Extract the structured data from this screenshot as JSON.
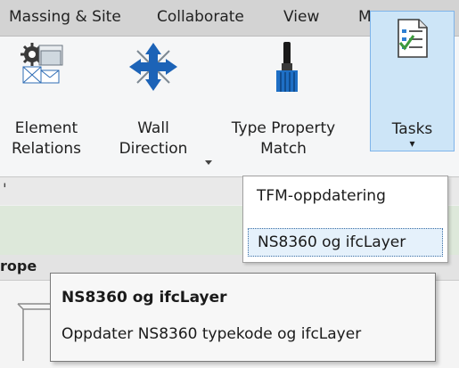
{
  "tabs": [
    "Massing & Site",
    "Collaborate",
    "View",
    "M"
  ],
  "ribbon": {
    "element_relations": {
      "line1": "Element",
      "line2": "Relations",
      "icon": "element-relations-icon"
    },
    "wall_direction": {
      "line1": "Wall",
      "line2": "Direction",
      "icon": "wall-direction-icon"
    },
    "type_property_match": {
      "line1": "Type Property",
      "line2": "Match",
      "icon": "paintbrush-icon"
    },
    "tasks": {
      "label": "Tasks",
      "arrow": "▾",
      "icon": "task-list-icon"
    }
  },
  "dropdown": {
    "items": [
      {
        "label": "TFM-oppdatering"
      },
      {
        "label": "NS8360 og ifcLayer"
      }
    ]
  },
  "tooltip": {
    "title": "NS8360 og ifcLayer",
    "description": "Oppdater NS8360 typekode og ifcLayer"
  },
  "properties": {
    "header_partial": "rope"
  },
  "colors": {
    "tasks_highlight": "#cde5f7",
    "tasks_border": "#7eb4ea",
    "arrow_blue": "#1c63b7",
    "checkmark_green": "#3c9a3c"
  }
}
